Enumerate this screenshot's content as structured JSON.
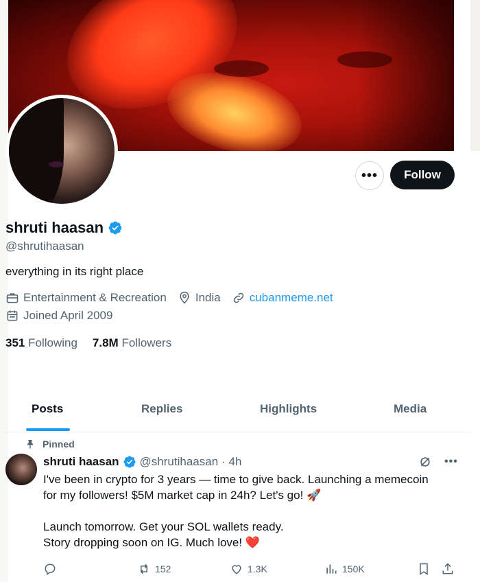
{
  "profile": {
    "name": "shruti haasan",
    "handle": "@shrutihaasan",
    "bio": "everything in its right place",
    "category": "Entertainment & Recreation",
    "location": "India",
    "website": "cubanmeme.net",
    "joined": "Joined April 2009",
    "following_count": "351",
    "following_label": "Following",
    "followers_count": "7.8M",
    "followers_label": "Followers"
  },
  "buttons": {
    "more": "•••",
    "follow": "Follow"
  },
  "tabs": [
    {
      "label": "Posts",
      "active": true
    },
    {
      "label": "Replies"
    },
    {
      "label": "Highlights"
    },
    {
      "label": "Media"
    }
  ],
  "post": {
    "pinned_label": "Pinned",
    "author": "shruti haasan",
    "handle": "@shrutihaasan",
    "time": "· 4h",
    "line1": "I've been in crypto for 3 years — time to give back. Launching a memecoin",
    "line2": "for my followers! $5M market cap in 24h? Let's go! 🚀",
    "line3": "Launch tomorrow. Get your SOL wallets ready.",
    "line4": "Story dropping soon on IG. Much love! ❤️",
    "reposts": "152",
    "likes": "1.3K",
    "views": "150K"
  },
  "colors": {
    "accent": "#1d9bf0",
    "text": "#0f1419",
    "muted": "#536471",
    "like_heart": "#e0245e"
  }
}
